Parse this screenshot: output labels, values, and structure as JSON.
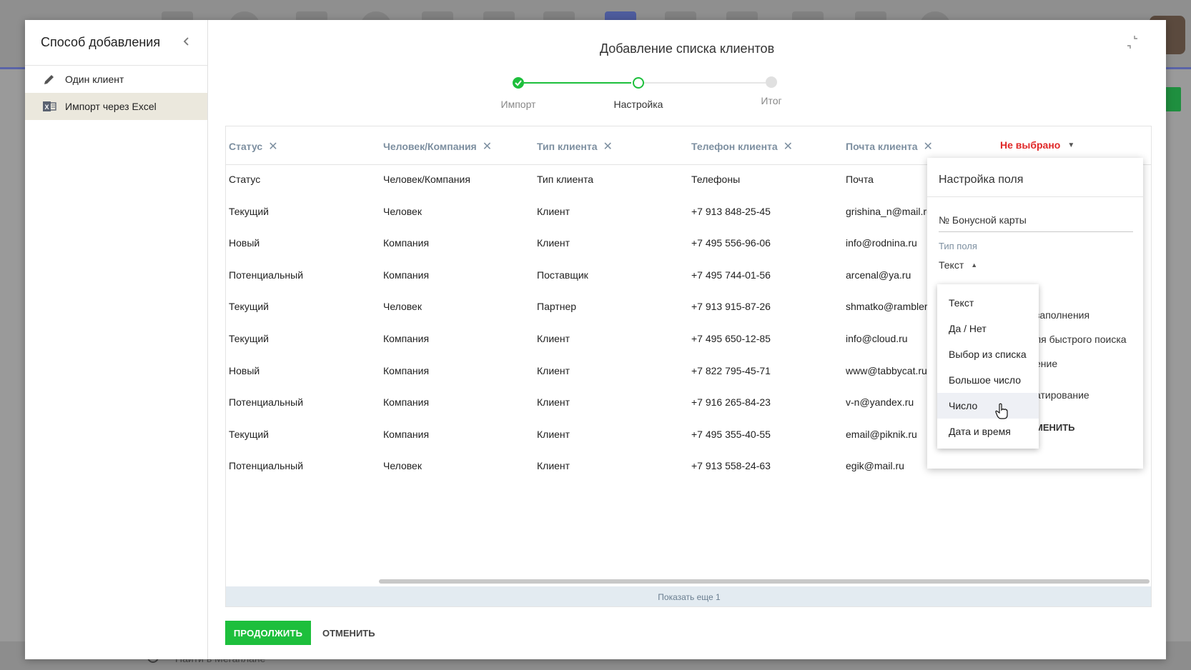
{
  "background": {
    "search_placeholder": "Найти в Мегаплане"
  },
  "sidebar": {
    "title": "Способ добавления",
    "items": [
      {
        "label": "Один клиент",
        "icon": "pencil-icon"
      },
      {
        "label": "Импорт через Excel",
        "icon": "excel-icon"
      }
    ]
  },
  "modal": {
    "title": "Добавление списка клиентов"
  },
  "stepper": {
    "steps": [
      {
        "label": "Импорт",
        "state": "done"
      },
      {
        "label": "Настройка",
        "state": "current"
      },
      {
        "label": "Итог",
        "state": "pending"
      }
    ]
  },
  "table": {
    "headers": [
      {
        "label": "Статус",
        "removable": true
      },
      {
        "label": "Человек/Компания",
        "removable": true
      },
      {
        "label": "Тип клиента",
        "removable": true
      },
      {
        "label": "Телефон клиента",
        "removable": true
      },
      {
        "label": "Почта клиента",
        "removable": true
      },
      {
        "label": "Не выбрано",
        "removable": false
      }
    ],
    "rows": [
      [
        "Статус",
        "Человек/Компания",
        "Тип клиента",
        "Телефоны",
        "Почта"
      ],
      [
        "Текущий",
        "Человек",
        "Клиент",
        "+7 913 848-25-45",
        "grishina_n@mail.ru"
      ],
      [
        "Новый",
        "Компания",
        "Клиент",
        "+7 495 556-96-06",
        "info@rodnina.ru"
      ],
      [
        "Потенциальный",
        "Компания",
        "Поставщик",
        "+7 495 744-01-56",
        "arcenal@ya.ru"
      ],
      [
        "Текущий",
        "Человек",
        "Партнер",
        "+7 913 915-87-26",
        "shmatko@rambler"
      ],
      [
        "Текущий",
        "Компания",
        "Клиент",
        "+7 495 650-12-85",
        "info@cloud.ru"
      ],
      [
        "Новый",
        "Компания",
        "Клиент",
        "+7 822 795-45-71",
        "www@tabbycat.ru"
      ],
      [
        "Потенциальный",
        "Компания",
        "Клиент",
        "+7 916 265-84-23",
        "v-n@yandex.ru"
      ],
      [
        "Текущий",
        "Компания",
        "Клиент",
        "+7 495 355-40-55",
        "email@piknik.ru"
      ],
      [
        "Потенциальный",
        "Человек",
        "Клиент",
        "+7 913 558-24-63",
        "egik@mail.ru"
      ]
    ],
    "show_more": "Показать еще 1"
  },
  "buttons": {
    "continue": "ПРОДОЛЖИТЬ",
    "cancel": "ОТМЕНИТЬ"
  },
  "popup": {
    "title": "Настройка поля",
    "field_name": "№ Бонусной карты",
    "type_label": "Тип поля",
    "type_value": "Текст",
    "partial_texts": [
      "заполнения",
      "ля быстрого поиска",
      "ение",
      "атирование",
      "МЕНИТЬ"
    ]
  },
  "dropdown": {
    "options": [
      "Текст",
      "Да / Нет",
      "Выбор из списка",
      "Большое число",
      "Число",
      "Дата и время"
    ],
    "hovered": "Число"
  },
  "colors": {
    "accent_green": "#1dbf3c",
    "header_text": "#7d8fa0",
    "unselected_red": "#e02828"
  }
}
